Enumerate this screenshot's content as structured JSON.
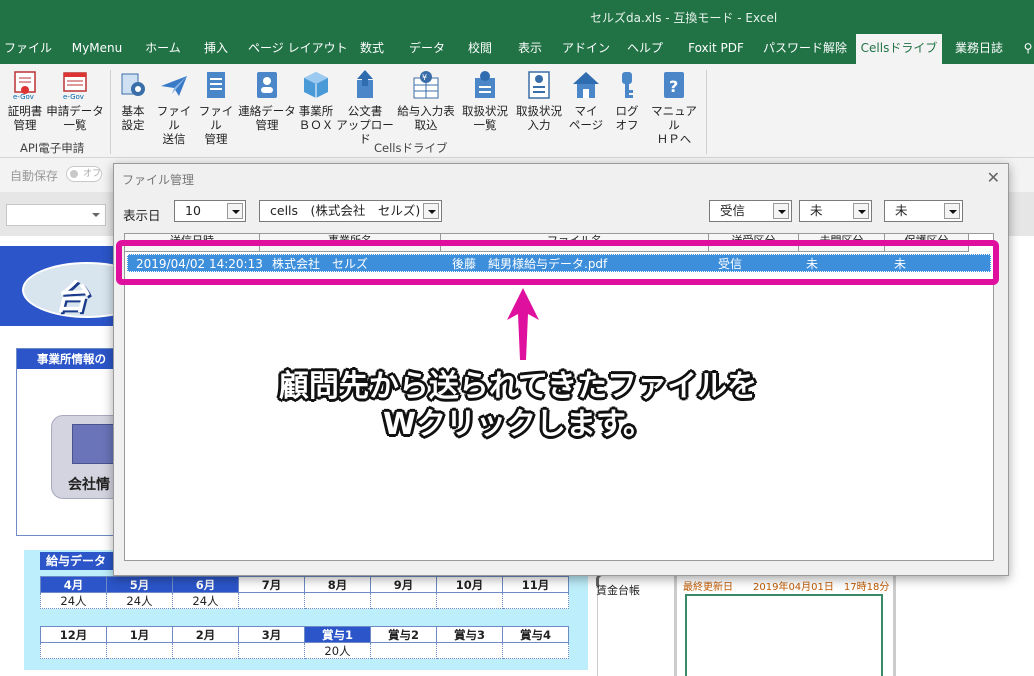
{
  "window": {
    "title": "セルズda.xls  -  互換モード  -  Excel"
  },
  "tabs": [
    {
      "label": "ファイル",
      "active": false
    },
    {
      "label": "MyMenu",
      "active": false
    },
    {
      "label": "ホーム",
      "active": false
    },
    {
      "label": "挿入",
      "active": false
    },
    {
      "label": "ページ レイアウト",
      "active": false
    },
    {
      "label": "数式",
      "active": false
    },
    {
      "label": "データ",
      "active": false
    },
    {
      "label": "校閲",
      "active": false
    },
    {
      "label": "表示",
      "active": false
    },
    {
      "label": "アドイン",
      "active": false
    },
    {
      "label": "ヘルプ",
      "active": false
    },
    {
      "label": "Foxit PDF",
      "active": false
    },
    {
      "label": "パスワード解除",
      "active": false
    },
    {
      "label": "Cellsドライブ",
      "active": true
    },
    {
      "label": "業務日誌",
      "active": false
    }
  ],
  "ribbon": {
    "groups": [
      "API電子申請",
      "Cellsドライブ"
    ],
    "buttons": [
      {
        "label": "証明書\n管理",
        "icon": "certificate-icon"
      },
      {
        "label": "申請データ\n一覧",
        "icon": "application-list-icon"
      },
      {
        "label": "基本\n設定",
        "icon": "gear-icon"
      },
      {
        "label": "ファイル\n送信",
        "icon": "paper-plane-icon"
      },
      {
        "label": "ファイル\n管理",
        "icon": "file-icon"
      },
      {
        "label": "連絡データ\n管理",
        "icon": "contact-card-icon"
      },
      {
        "label": "事業所\nＢＯＸ",
        "icon": "box-icon"
      },
      {
        "label": "公文書\nアップロード",
        "icon": "upload-icon"
      },
      {
        "label": "給与入力表\n取込",
        "icon": "yen-table-icon"
      },
      {
        "label": "取扱状況\n一覧",
        "icon": "status-list-icon"
      },
      {
        "label": "取扱状況\n入力",
        "icon": "status-input-icon"
      },
      {
        "label": "マイ\nページ",
        "icon": "home-icon"
      },
      {
        "label": "ログ\nオフ",
        "icon": "key-icon"
      },
      {
        "label": "マニュアル\nＨＰへ",
        "icon": "help-icon"
      }
    ]
  },
  "qat": {
    "autosave_label": "自動保存",
    "autosave_state": "オフ"
  },
  "dialog": {
    "title": "ファイル管理",
    "display_days_label": "表示日",
    "display_days_value": "10",
    "company_select": "cells　(株式会社　セルズ)",
    "filter_direction": "受信",
    "filter_read": "未",
    "filter_saved": "未",
    "columns": [
      "送信日時",
      "事業所名",
      "ファイル名",
      "送受区分",
      "未開区分",
      "保護区分"
    ],
    "rows": [
      {
        "datetime": "2019/04/02 14:20:13",
        "office": "株式会社　セルズ",
        "file": "後藤　純男様給与データ.pdf",
        "direction": "受信",
        "opened": "未",
        "saved": "未"
      }
    ]
  },
  "annotation": {
    "line1": "顧問先から送られてきたファイルを",
    "line2": "Wクリックします。",
    "color": "#e0109f"
  },
  "sheet": {
    "jigyo_header": "事業所情報の",
    "company_button": "会社情",
    "salary_header": "給与データ",
    "months1": [
      "4月",
      "5月",
      "6月",
      "7月",
      "8月",
      "9月",
      "10月",
      "11月"
    ],
    "counts1": [
      "24人",
      "24人",
      "24人",
      "",
      "",
      "",
      "",
      ""
    ],
    "months2": [
      "12月",
      "1月",
      "2月",
      "3月",
      "賞与1",
      "賞与2",
      "賞与3",
      "賞与4"
    ],
    "counts2": [
      "",
      "",
      "",
      "",
      "20人",
      "",
      "",
      ""
    ],
    "ledger_label": "賃金台帳",
    "last_updated": "最終更新日　　2019年04月01日　17時18分"
  }
}
